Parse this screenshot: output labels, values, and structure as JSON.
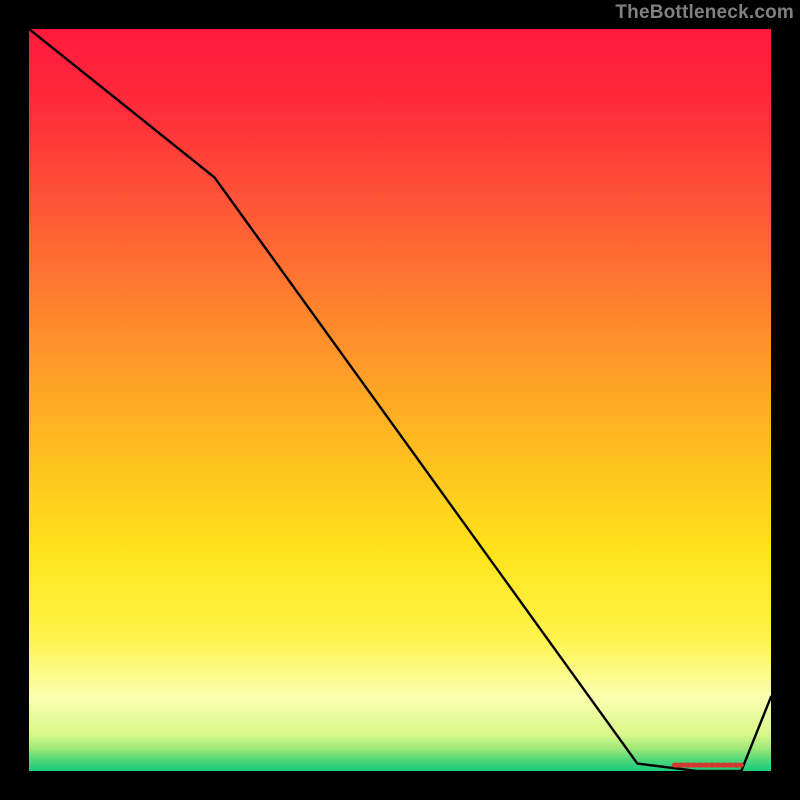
{
  "attribution": "TheBottleneck.com",
  "colors": {
    "frame": "#000000",
    "attribution_text": "#808080",
    "line": "#000000",
    "marker": "#d13a2f"
  },
  "chart_data": {
    "type": "line",
    "title": "",
    "xlabel": "",
    "ylabel": "",
    "xlim": [
      0,
      100
    ],
    "ylim": [
      0,
      100
    ],
    "grid": false,
    "legend": false,
    "background": "rainbow-gradient (red→orange→yellow→light-yellow→green at very bottom)",
    "series": [
      {
        "name": "curve",
        "x": [
          0,
          25,
          82,
          90,
          96,
          100
        ],
        "y": [
          100,
          80,
          1,
          0,
          0,
          10
        ]
      }
    ],
    "marker_segment": {
      "name": "flat-bottom",
      "x": [
        87,
        96
      ],
      "y": [
        0.8,
        0.8
      ]
    }
  }
}
